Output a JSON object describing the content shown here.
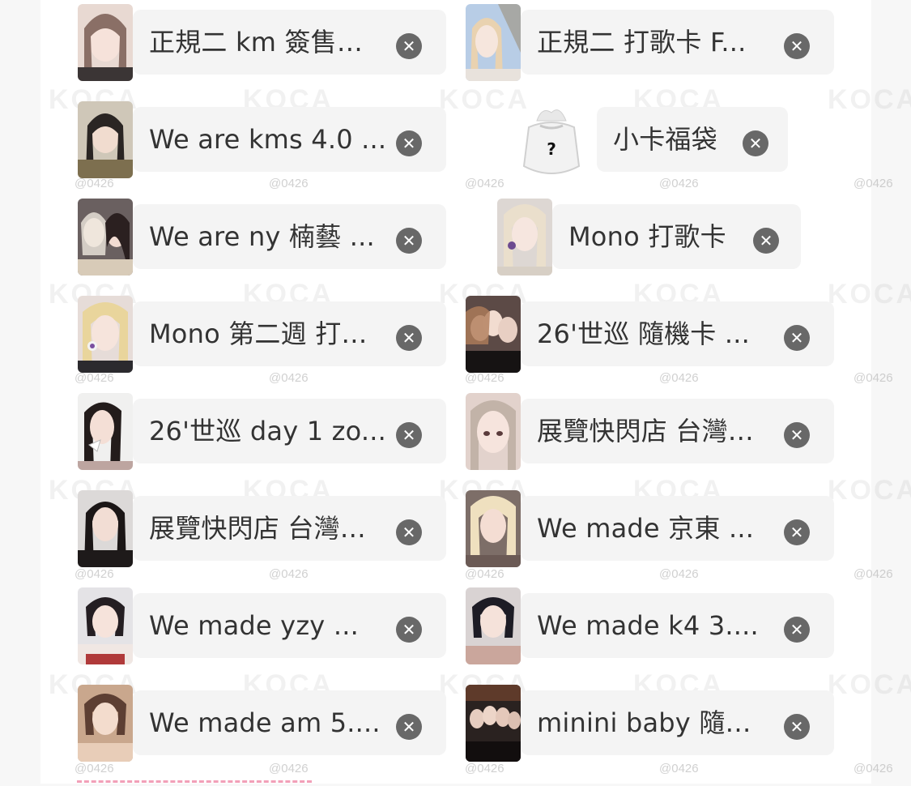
{
  "watermark": {
    "brand": "KOCA",
    "id": "@0426"
  },
  "items": [
    {
      "label": "正規二 km 簽售…",
      "remove_icon": "✕"
    },
    {
      "label": "正規二 打歌卡 F...",
      "remove_icon": "✕"
    },
    {
      "label": "We are kms 4.0 ...",
      "remove_icon": "✕"
    },
    {
      "label": "小卡福袋",
      "remove_icon": "✕",
      "image_text": "?"
    },
    {
      "label": "We are ny 楠藝 ...",
      "remove_icon": "✕"
    },
    {
      "label": "Mono 打歌卡",
      "remove_icon": "✕"
    },
    {
      "label": "Mono 第二週 打…",
      "remove_icon": "✕"
    },
    {
      "label": "26'世巡 隨機卡 ...",
      "remove_icon": "✕"
    },
    {
      "label": "26'世巡 day 1 zo...",
      "remove_icon": "✕"
    },
    {
      "label": "展覽快閃店 台灣…",
      "remove_icon": "✕"
    },
    {
      "label": "展覽快閃店 台灣…",
      "remove_icon": "✕"
    },
    {
      "label": "We made 京東 ...",
      "remove_icon": "✕"
    },
    {
      "label": "We made yzy ...",
      "remove_icon": "✕"
    },
    {
      "label": "We made k4 3....",
      "remove_icon": "✕"
    },
    {
      "label": "We made am 5....",
      "remove_icon": "✕"
    },
    {
      "label": "minini baby 隨…",
      "remove_icon": "✕"
    }
  ],
  "colors": {
    "pill_bg": "#f4f4f4",
    "remove_bg": "#686868",
    "accent_dashed": "#f2a0b8"
  }
}
